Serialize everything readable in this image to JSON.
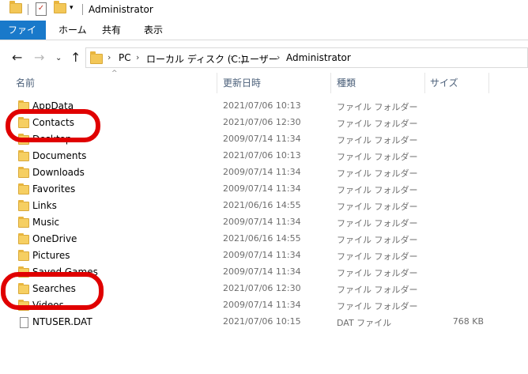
{
  "window": {
    "title": "Administrator"
  },
  "ribbon": {
    "tabs": [
      "ファイル",
      "ホーム",
      "共有",
      "表示"
    ]
  },
  "address": {
    "crumbs": [
      "PC",
      "ローカル ディスク (C:)",
      "ユーザー",
      "Administrator"
    ]
  },
  "columns": {
    "name": "名前",
    "date": "更新日時",
    "type": "種類",
    "size": "サイズ"
  },
  "files": [
    {
      "name": "AppData",
      "date": "2021/07/06 10:13",
      "type": "ファイル フォルダー",
      "size": "",
      "icon": "folder-icon"
    },
    {
      "name": "Contacts",
      "date": "2021/07/06 12:30",
      "type": "ファイル フォルダー",
      "size": "",
      "icon": "folder-icon"
    },
    {
      "name": "Desktop",
      "date": "2009/07/14 11:34",
      "type": "ファイル フォルダー",
      "size": "",
      "icon": "folder-icon"
    },
    {
      "name": "Documents",
      "date": "2021/07/06 10:13",
      "type": "ファイル フォルダー",
      "size": "",
      "icon": "folder-icon"
    },
    {
      "name": "Downloads",
      "date": "2009/07/14 11:34",
      "type": "ファイル フォルダー",
      "size": "",
      "icon": "folder-icon"
    },
    {
      "name": "Favorites",
      "date": "2009/07/14 11:34",
      "type": "ファイル フォルダー",
      "size": "",
      "icon": "folder-icon"
    },
    {
      "name": "Links",
      "date": "2021/06/16 14:55",
      "type": "ファイル フォルダー",
      "size": "",
      "icon": "folder-icon"
    },
    {
      "name": "Music",
      "date": "2009/07/14 11:34",
      "type": "ファイル フォルダー",
      "size": "",
      "icon": "folder-icon"
    },
    {
      "name": "OneDrive",
      "date": "2021/06/16 14:55",
      "type": "ファイル フォルダー",
      "size": "",
      "icon": "folder-icon"
    },
    {
      "name": "Pictures",
      "date": "2009/07/14 11:34",
      "type": "ファイル フォルダー",
      "size": "",
      "icon": "folder-icon"
    },
    {
      "name": "Saved Games",
      "date": "2009/07/14 11:34",
      "type": "ファイル フォルダー",
      "size": "",
      "icon": "folder-icon"
    },
    {
      "name": "Searches",
      "date": "2021/07/06 12:30",
      "type": "ファイル フォルダー",
      "size": "",
      "icon": "folder-icon"
    },
    {
      "name": "Videos",
      "date": "2009/07/14 11:34",
      "type": "ファイル フォルダー",
      "size": "",
      "icon": "folder-icon"
    },
    {
      "name": "NTUSER.DAT",
      "date": "2021/07/06 10:15",
      "type": "DAT ファイル",
      "size": "768 KB",
      "icon": "file-icon"
    }
  ],
  "colors": {
    "accent": "#1979ca",
    "annotation": "#e00000",
    "folder": "#f6cf62"
  }
}
